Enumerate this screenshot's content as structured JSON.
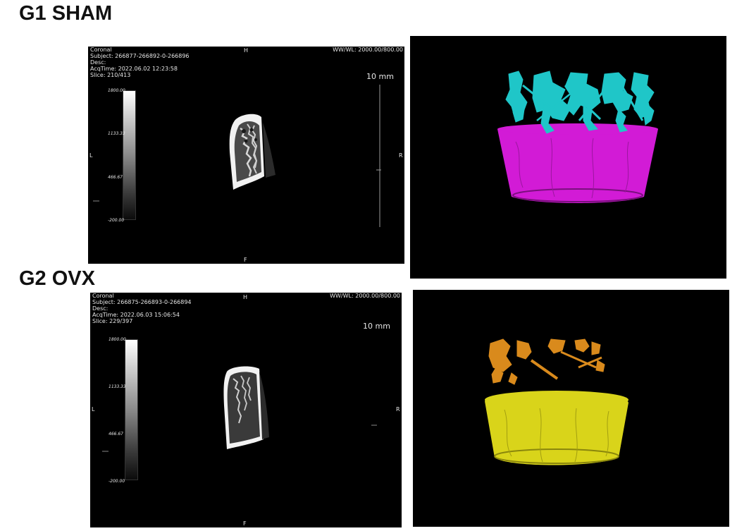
{
  "groups": [
    {
      "title": "G1 SHAM",
      "ct_view": {
        "plane": "Coronal",
        "subject": "Subject: 266877-266892-0-266896",
        "desc": "Desc:",
        "acq_time": "AcqTime: 2022.06.02 12:23:58",
        "slice": "Slice: 210/413",
        "window": "WW/WL: 2000.00/800.00",
        "orientation": {
          "top": "H",
          "bottom": "F",
          "left": "L",
          "right": "R"
        },
        "scale_bar": "10 mm",
        "colorbar_ticks": [
          "1800.00",
          "1133.33",
          "466.67",
          "-200.00"
        ]
      },
      "render": {
        "trabecular_color": "#1fc6c8",
        "cortical_color": "#d21bd6"
      }
    },
    {
      "title": "G2 OVX",
      "ct_view": {
        "plane": "Coronal",
        "subject": "Subject: 266875-266893-0-266894",
        "desc": "Desc:",
        "acq_time": "AcqTime: 2022.06.03 15:06:54",
        "slice": "Slice: 229/397",
        "window": "WW/WL: 2000.00/800.00",
        "orientation": {
          "top": "H",
          "bottom": "F",
          "left": "L",
          "right": "R"
        },
        "scale_bar": "10 mm",
        "colorbar_ticks": [
          "1800.00",
          "1133.33",
          "466.67",
          "-200.00"
        ]
      },
      "render": {
        "trabecular_color": "#d98a1c",
        "cortical_color": "#d9d41a"
      }
    }
  ]
}
